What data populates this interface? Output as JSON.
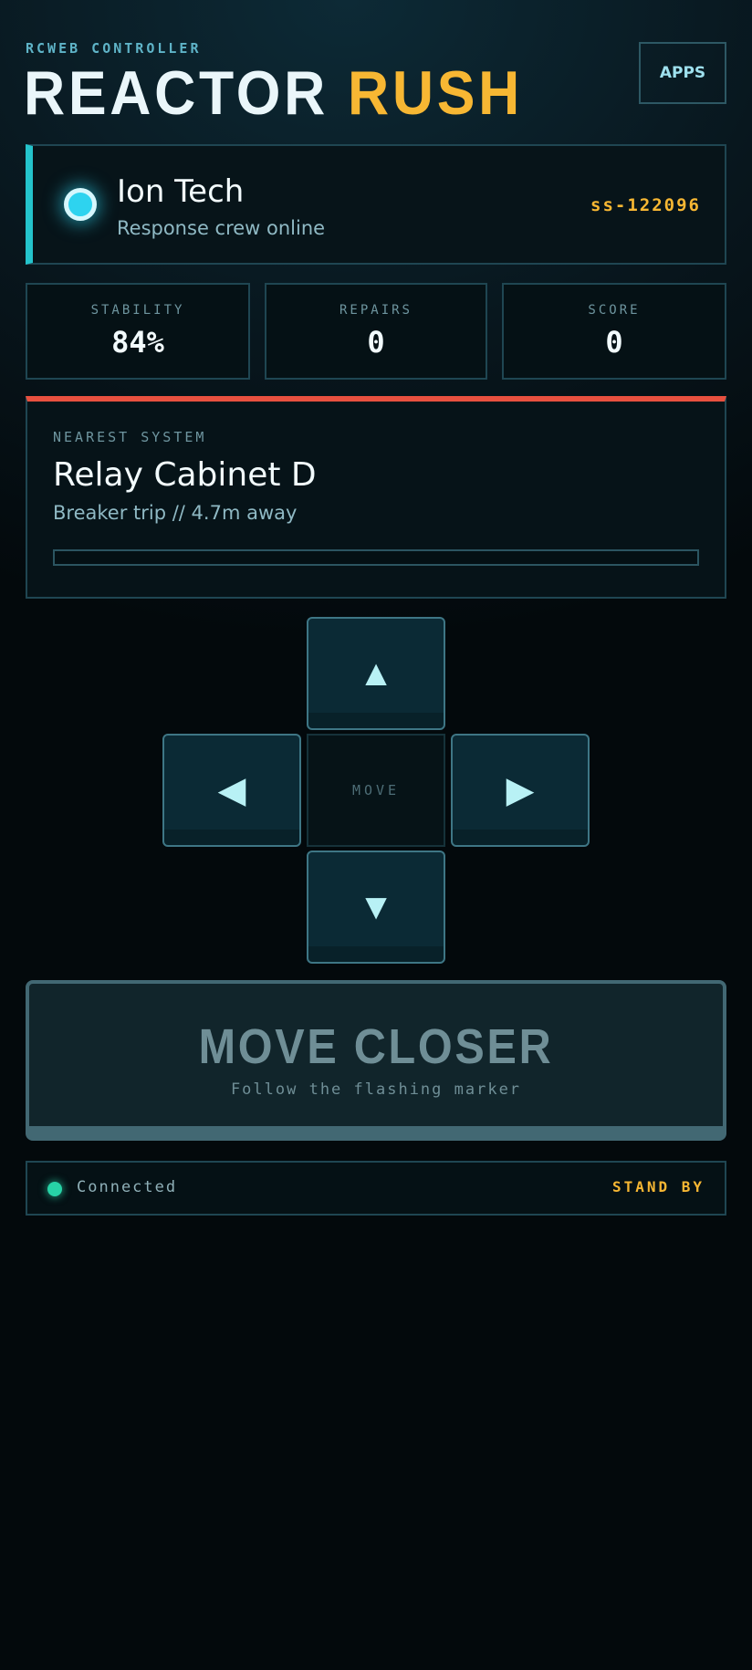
{
  "header": {
    "eyebrow": "RCWEB CONTROLLER",
    "title_part1": "REACTOR",
    "title_part2": "RUSH",
    "apps_label": "APPS"
  },
  "player": {
    "name": "Ion Tech",
    "status": "Response crew online",
    "id": "ss-122096"
  },
  "stats": [
    {
      "label": "STABILITY",
      "value": "84%"
    },
    {
      "label": "REPAIRS",
      "value": "0"
    },
    {
      "label": "SCORE",
      "value": "0"
    }
  ],
  "nearest_system": {
    "label": "NEAREST SYSTEM",
    "name": "Relay Cabinet D",
    "detail": "Breaker trip // 4.7m away",
    "progress": 0
  },
  "dpad": {
    "up": "▲",
    "left": "◀",
    "right": "▶",
    "down": "▼",
    "center_label": "MOVE"
  },
  "action": {
    "title": "MOVE CLOSER",
    "subtitle": "Follow the flashing marker"
  },
  "footer": {
    "connection": "Connected",
    "state": "STAND BY"
  },
  "colors": {
    "accent_cyan": "#24c4cc",
    "accent_gold": "#f7b733",
    "alert_red": "#e8503f",
    "connected_green": "#27d3a6"
  }
}
